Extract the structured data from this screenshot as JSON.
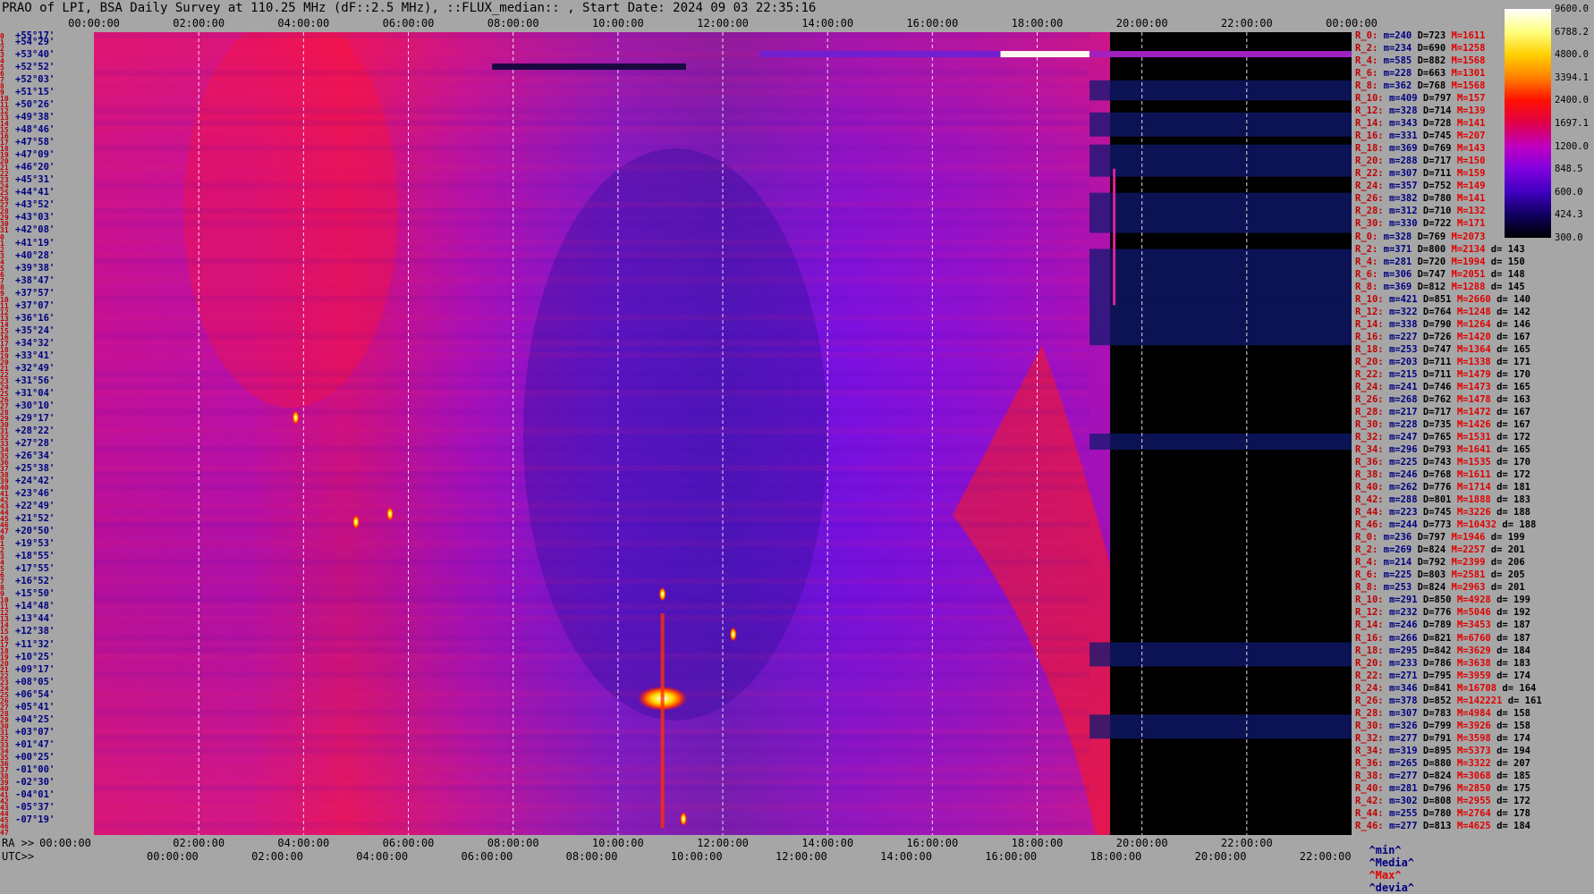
{
  "title": "PRAO of LPI, BSA Daily Survey at 110.25 MHz (dF::2.5 MHz), ::FLUX_median:: , Start Date: 2024 09 03 22:35:16",
  "top_axis_ticks": [
    "00:00:00",
    "02:00:00",
    "04:00:00",
    "06:00:00",
    "08:00:00",
    "10:00:00",
    "12:00:00",
    "14:00:00",
    "16:00:00",
    "18:00:00",
    "20:00:00",
    "22:00:00",
    "00:00:00"
  ],
  "bottom_ra_prefix": "RA >>",
  "bottom_ra_ticks": [
    "00:00:00",
    "02:00:00",
    "04:00:00",
    "06:00:00",
    "08:00:00",
    "10:00:00",
    "12:00:00",
    "14:00:00",
    "16:00:00",
    "18:00:00",
    "20:00:00",
    "22:00:00"
  ],
  "bottom_utc_prefix": "UTC>>",
  "bottom_utc_ticks": [
    "00:00:00",
    "02:00:00",
    "04:00:00",
    "06:00:00",
    "08:00:00",
    "10:00:00",
    "12:00:00",
    "14:00:00",
    "16:00:00",
    "18:00:00",
    "20:00:00",
    "22:00:00"
  ],
  "colorbar": {
    "labels": [
      "9600.0",
      "6788.2",
      "4800.0",
      "3394.1",
      "2400.0",
      "1697.1",
      "1200.0",
      "848.5",
      "600.0",
      "424.3",
      "300.0"
    ],
    "colors": [
      "#ffffff",
      "#ffff80",
      "#ffd000",
      "#ff8000",
      "#ff1000",
      "#e0004a",
      "#c000c0",
      "#8000e0",
      "#4000c0",
      "#100060",
      "#000000"
    ]
  },
  "footer": {
    "min": "^min^",
    "median": "^Media^",
    "max": "^Max^",
    "dev": "^devia^"
  },
  "declinations": [
    {
      "i": "0",
      "dec": "+55°17'"
    },
    {
      "i": "1",
      "dec": "+54°29'"
    },
    {
      "i": "2",
      "dec": ""
    },
    {
      "i": "3",
      "dec": "+53°40'"
    },
    {
      "i": "4",
      "dec": ""
    },
    {
      "i": "5",
      "dec": "+52°52'"
    },
    {
      "i": "6",
      "dec": ""
    },
    {
      "i": "7",
      "dec": "+52°03'"
    },
    {
      "i": "8",
      "dec": ""
    },
    {
      "i": "9",
      "dec": "+51°15'"
    },
    {
      "i": "10",
      "dec": ""
    },
    {
      "i": "11",
      "dec": "+50°26'"
    },
    {
      "i": "12",
      "dec": ""
    },
    {
      "i": "13",
      "dec": "+49°38'"
    },
    {
      "i": "14",
      "dec": ""
    },
    {
      "i": "15",
      "dec": "+48°46'"
    },
    {
      "i": "16",
      "dec": ""
    },
    {
      "i": "17",
      "dec": "+47°58'"
    },
    {
      "i": "18",
      "dec": ""
    },
    {
      "i": "19",
      "dec": "+47°09'"
    },
    {
      "i": "20",
      "dec": ""
    },
    {
      "i": "21",
      "dec": "+46°20'"
    },
    {
      "i": "22",
      "dec": ""
    },
    {
      "i": "23",
      "dec": "+45°31'"
    },
    {
      "i": "24",
      "dec": ""
    },
    {
      "i": "25",
      "dec": "+44°41'"
    },
    {
      "i": "26",
      "dec": ""
    },
    {
      "i": "27",
      "dec": "+43°52'"
    },
    {
      "i": "28",
      "dec": ""
    },
    {
      "i": "29",
      "dec": "+43°03'"
    },
    {
      "i": "30",
      "dec": ""
    },
    {
      "i": "31",
      "dec": "+42°08'"
    },
    {
      "i": "0",
      "dec": ""
    },
    {
      "i": "1",
      "dec": "+41°19'"
    },
    {
      "i": "2",
      "dec": ""
    },
    {
      "i": "3",
      "dec": "+40°28'"
    },
    {
      "i": "4",
      "dec": ""
    },
    {
      "i": "5",
      "dec": "+39°38'"
    },
    {
      "i": "6",
      "dec": ""
    },
    {
      "i": "7",
      "dec": "+38°47'"
    },
    {
      "i": "8",
      "dec": ""
    },
    {
      "i": "9",
      "dec": "+37°57'"
    },
    {
      "i": "10",
      "dec": ""
    },
    {
      "i": "11",
      "dec": "+37°07'"
    },
    {
      "i": "12",
      "dec": ""
    },
    {
      "i": "13",
      "dec": "+36°16'"
    },
    {
      "i": "14",
      "dec": ""
    },
    {
      "i": "15",
      "dec": "+35°24'"
    },
    {
      "i": "16",
      "dec": ""
    },
    {
      "i": "17",
      "dec": "+34°32'"
    },
    {
      "i": "18",
      "dec": ""
    },
    {
      "i": "19",
      "dec": "+33°41'"
    },
    {
      "i": "20",
      "dec": ""
    },
    {
      "i": "21",
      "dec": "+32°49'"
    },
    {
      "i": "22",
      "dec": ""
    },
    {
      "i": "23",
      "dec": "+31°56'"
    },
    {
      "i": "24",
      "dec": ""
    },
    {
      "i": "25",
      "dec": "+31°04'"
    },
    {
      "i": "26",
      "dec": ""
    },
    {
      "i": "27",
      "dec": "+30°10'"
    },
    {
      "i": "28",
      "dec": ""
    },
    {
      "i": "29",
      "dec": "+29°17'"
    },
    {
      "i": "30",
      "dec": ""
    },
    {
      "i": "31",
      "dec": "+28°22'"
    },
    {
      "i": "32",
      "dec": ""
    },
    {
      "i": "33",
      "dec": "+27°28'"
    },
    {
      "i": "34",
      "dec": ""
    },
    {
      "i": "35",
      "dec": "+26°34'"
    },
    {
      "i": "36",
      "dec": ""
    },
    {
      "i": "37",
      "dec": "+25°38'"
    },
    {
      "i": "38",
      "dec": ""
    },
    {
      "i": "39",
      "dec": "+24°42'"
    },
    {
      "i": "40",
      "dec": ""
    },
    {
      "i": "41",
      "dec": "+23°46'"
    },
    {
      "i": "42",
      "dec": ""
    },
    {
      "i": "43",
      "dec": "+22°49'"
    },
    {
      "i": "44",
      "dec": ""
    },
    {
      "i": "45",
      "dec": "+21°52'"
    },
    {
      "i": "46",
      "dec": ""
    },
    {
      "i": "47",
      "dec": "+20°50'"
    },
    {
      "i": "0",
      "dec": ""
    },
    {
      "i": "1",
      "dec": "+19°53'"
    },
    {
      "i": "2",
      "dec": ""
    },
    {
      "i": "3",
      "dec": "+18°55'"
    },
    {
      "i": "4",
      "dec": ""
    },
    {
      "i": "5",
      "dec": "+17°55'"
    },
    {
      "i": "6",
      "dec": ""
    },
    {
      "i": "7",
      "dec": "+16°52'"
    },
    {
      "i": "8",
      "dec": ""
    },
    {
      "i": "9",
      "dec": "+15°50'"
    },
    {
      "i": "10",
      "dec": ""
    },
    {
      "i": "11",
      "dec": "+14°48'"
    },
    {
      "i": "12",
      "dec": ""
    },
    {
      "i": "13",
      "dec": "+13°44'"
    },
    {
      "i": "14",
      "dec": ""
    },
    {
      "i": "15",
      "dec": "+12°38'"
    },
    {
      "i": "16",
      "dec": ""
    },
    {
      "i": "17",
      "dec": "+11°32'"
    },
    {
      "i": "18",
      "dec": ""
    },
    {
      "i": "19",
      "dec": "+10°25'"
    },
    {
      "i": "20",
      "dec": ""
    },
    {
      "i": "21",
      "dec": "+09°17'"
    },
    {
      "i": "22",
      "dec": ""
    },
    {
      "i": "23",
      "dec": "+08°05'"
    },
    {
      "i": "24",
      "dec": ""
    },
    {
      "i": "25",
      "dec": "+06°54'"
    },
    {
      "i": "26",
      "dec": ""
    },
    {
      "i": "27",
      "dec": "+05°41'"
    },
    {
      "i": "28",
      "dec": ""
    },
    {
      "i": "29",
      "dec": "+04°25'"
    },
    {
      "i": "30",
      "dec": ""
    },
    {
      "i": "31",
      "dec": "+03°07'"
    },
    {
      "i": "32",
      "dec": ""
    },
    {
      "i": "33",
      "dec": "+01°47'"
    },
    {
      "i": "34",
      "dec": ""
    },
    {
      "i": "35",
      "dec": "+00°25'"
    },
    {
      "i": "36",
      "dec": ""
    },
    {
      "i": "37",
      "dec": "-01°00'"
    },
    {
      "i": "38",
      "dec": ""
    },
    {
      "i": "39",
      "dec": "-02°30'"
    },
    {
      "i": "40",
      "dec": ""
    },
    {
      "i": "41",
      "dec": "-04°01'"
    },
    {
      "i": "42",
      "dec": ""
    },
    {
      "i": "43",
      "dec": "-05°37'"
    },
    {
      "i": "44",
      "dec": ""
    },
    {
      "i": "45",
      "dec": "-07°19'"
    },
    {
      "i": "46",
      "dec": ""
    },
    {
      "i": "47",
      "dec": ""
    }
  ],
  "stats": [
    {
      "r": "R_0:",
      "m": "m=240",
      "d": "D=723",
      "M": "M=1611",
      "dev": ""
    },
    {
      "r": "R_2:",
      "m": "m=234",
      "d": "D=690",
      "M": "M=1258",
      "dev": ""
    },
    {
      "r": "R_4:",
      "m": "m=585",
      "d": "D=882",
      "M": "M=1568",
      "dev": ""
    },
    {
      "r": "R_6:",
      "m": "m=228",
      "d": "D=663",
      "M": "M=1301",
      "dev": ""
    },
    {
      "r": "R_8:",
      "m": "m=362",
      "d": "D=768",
      "M": "M=1568",
      "dev": ""
    },
    {
      "r": "R_10:",
      "m": "m=409",
      "d": "D=797",
      "M": "M=157",
      "dev": ""
    },
    {
      "r": "R_12:",
      "m": "m=328",
      "d": "D=714",
      "M": "M=139",
      "dev": ""
    },
    {
      "r": "R_14:",
      "m": "m=343",
      "d": "D=728",
      "M": "M=141",
      "dev": ""
    },
    {
      "r": "R_16:",
      "m": "m=331",
      "d": "D=745",
      "M": "M=207",
      "dev": ""
    },
    {
      "r": "R_18:",
      "m": "m=369",
      "d": "D=769",
      "M": "M=143",
      "dev": ""
    },
    {
      "r": "R_20:",
      "m": "m=288",
      "d": "D=717",
      "M": "M=150",
      "dev": ""
    },
    {
      "r": "R_22:",
      "m": "m=307",
      "d": "D=711",
      "M": "M=159",
      "dev": ""
    },
    {
      "r": "R_24:",
      "m": "m=357",
      "d": "D=752",
      "M": "M=149",
      "dev": ""
    },
    {
      "r": "R_26:",
      "m": "m=382",
      "d": "D=780",
      "M": "M=141",
      "dev": ""
    },
    {
      "r": "R_28:",
      "m": "m=312",
      "d": "D=710",
      "M": "M=132",
      "dev": ""
    },
    {
      "r": "R_30:",
      "m": "m=330",
      "d": "D=722",
      "M": "M=171",
      "dev": ""
    },
    {
      "r": "R_0:",
      "m": "m=328",
      "d": "D=769",
      "M": "M=2073",
      "dev": ""
    },
    {
      "r": "R_2:",
      "m": "m=371",
      "d": "D=800",
      "M": "M=2134",
      "dev": "d= 143"
    },
    {
      "r": "R_4:",
      "m": "m=281",
      "d": "D=720",
      "M": "M=1994",
      "dev": "d= 150"
    },
    {
      "r": "R_6:",
      "m": "m=306",
      "d": "D=747",
      "M": "M=2051",
      "dev": "d= 148"
    },
    {
      "r": "R_8:",
      "m": "m=369",
      "d": "D=812",
      "M": "M=1288",
      "dev": "d= 145"
    },
    {
      "r": "R_10:",
      "m": "m=421",
      "d": "D=851",
      "M": "M=2660",
      "dev": "d= 140"
    },
    {
      "r": "R_12:",
      "m": "m=322",
      "d": "D=764",
      "M": "M=1248",
      "dev": "d= 142"
    },
    {
      "r": "R_14:",
      "m": "m=338",
      "d": "D=790",
      "M": "M=1264",
      "dev": "d= 146"
    },
    {
      "r": "R_16:",
      "m": "m=227",
      "d": "D=726",
      "M": "M=1420",
      "dev": "d= 167"
    },
    {
      "r": "R_18:",
      "m": "m=253",
      "d": "D=747",
      "M": "M=1364",
      "dev": "d= 165"
    },
    {
      "r": "R_20:",
      "m": "m=203",
      "d": "D=711",
      "M": "M=1338",
      "dev": "d= 171"
    },
    {
      "r": "R_22:",
      "m": "m=215",
      "d": "D=711",
      "M": "M=1479",
      "dev": "d= 170"
    },
    {
      "r": "R_24:",
      "m": "m=241",
      "d": "D=746",
      "M": "M=1473",
      "dev": "d= 165"
    },
    {
      "r": "R_26:",
      "m": "m=268",
      "d": "D=762",
      "M": "M=1478",
      "dev": "d= 163"
    },
    {
      "r": "R_28:",
      "m": "m=217",
      "d": "D=717",
      "M": "M=1472",
      "dev": "d= 167"
    },
    {
      "r": "R_30:",
      "m": "m=228",
      "d": "D=735",
      "M": "M=1426",
      "dev": "d= 167"
    },
    {
      "r": "R_32:",
      "m": "m=247",
      "d": "D=765",
      "M": "M=1531",
      "dev": "d= 172"
    },
    {
      "r": "R_34:",
      "m": "m=296",
      "d": "D=793",
      "M": "M=1641",
      "dev": "d= 165"
    },
    {
      "r": "R_36:",
      "m": "m=225",
      "d": "D=743",
      "M": "M=1535",
      "dev": "d= 170"
    },
    {
      "r": "R_38:",
      "m": "m=246",
      "d": "D=768",
      "M": "M=1611",
      "dev": "d= 172"
    },
    {
      "r": "R_40:",
      "m": "m=262",
      "d": "D=776",
      "M": "M=1714",
      "dev": "d= 181"
    },
    {
      "r": "R_42:",
      "m": "m=288",
      "d": "D=801",
      "M": "M=1888",
      "dev": "d= 183"
    },
    {
      "r": "R_44:",
      "m": "m=223",
      "d": "D=745",
      "M": "M=3226",
      "dev": "d= 188"
    },
    {
      "r": "R_46:",
      "m": "m=244",
      "d": "D=773",
      "M": "M=10432",
      "dev": "d= 188"
    },
    {
      "r": "R_0:",
      "m": "m=236",
      "d": "D=797",
      "M": "M=1946",
      "dev": "d= 199"
    },
    {
      "r": "R_2:",
      "m": "m=269",
      "d": "D=824",
      "M": "M=2257",
      "dev": "d= 201"
    },
    {
      "r": "R_4:",
      "m": "m=214",
      "d": "D=792",
      "M": "M=2399",
      "dev": "d= 206"
    },
    {
      "r": "R_6:",
      "m": "m=225",
      "d": "D=803",
      "M": "M=2581",
      "dev": "d= 205"
    },
    {
      "r": "R_8:",
      "m": "m=253",
      "d": "D=824",
      "M": "M=2963",
      "dev": "d= 201"
    },
    {
      "r": "R_10:",
      "m": "m=291",
      "d": "D=850",
      "M": "M=4928",
      "dev": "d= 199"
    },
    {
      "r": "R_12:",
      "m": "m=232",
      "d": "D=776",
      "M": "M=5046",
      "dev": "d= 192"
    },
    {
      "r": "R_14:",
      "m": "m=246",
      "d": "D=789",
      "M": "M=3453",
      "dev": "d= 187"
    },
    {
      "r": "R_16:",
      "m": "m=266",
      "d": "D=821",
      "M": "M=6760",
      "dev": "d= 187"
    },
    {
      "r": "R_18:",
      "m": "m=295",
      "d": "D=842",
      "M": "M=3629",
      "dev": "d= 184"
    },
    {
      "r": "R_20:",
      "m": "m=233",
      "d": "D=786",
      "M": "M=3638",
      "dev": "d= 183"
    },
    {
      "r": "R_22:",
      "m": "m=271",
      "d": "D=795",
      "M": "M=3959",
      "dev": "d= 174"
    },
    {
      "r": "R_24:",
      "m": "m=346",
      "d": "D=841",
      "M": "M=16708",
      "dev": "d= 164"
    },
    {
      "r": "R_26:",
      "m": "m=378",
      "d": "D=852",
      "M": "M=142221",
      "dev": "d= 161"
    },
    {
      "r": "R_28:",
      "m": "m=307",
      "d": "D=783",
      "M": "M=4984",
      "dev": "d= 158"
    },
    {
      "r": "R_30:",
      "m": "m=326",
      "d": "D=799",
      "M": "M=3926",
      "dev": "d= 158"
    },
    {
      "r": "R_32:",
      "m": "m=277",
      "d": "D=791",
      "M": "M=3598",
      "dev": "d= 174"
    },
    {
      "r": "R_34:",
      "m": "m=319",
      "d": "D=895",
      "M": "M=5373",
      "dev": "d= 194"
    },
    {
      "r": "R_36:",
      "m": "m=265",
      "d": "D=880",
      "M": "M=3322",
      "dev": "d= 207"
    },
    {
      "r": "R_38:",
      "m": "m=277",
      "d": "D=824",
      "M": "M=3068",
      "dev": "d= 185"
    },
    {
      "r": "R_40:",
      "m": "m=281",
      "d": "D=796",
      "M": "M=2850",
      "dev": "d= 175"
    },
    {
      "r": "R_42:",
      "m": "m=302",
      "d": "D=808",
      "M": "M=2955",
      "dev": "d= 172"
    },
    {
      "r": "R_44:",
      "m": "m=255",
      "d": "D=780",
      "M": "M=2764",
      "dev": "d= 178"
    },
    {
      "r": "R_46:",
      "m": "m=277",
      "d": "D=813",
      "M": "M=4625",
      "dev": "d= 184"
    }
  ],
  "chart_data": {
    "type": "heatmap",
    "x_axis": "UTC (hours)",
    "x_range": [
      0,
      24
    ],
    "y_rows": 128,
    "colormap_range": [
      300.0,
      9600.0
    ],
    "colormap_scale": "log",
    "data_gap_start_hour": 19.0,
    "bright_sources": [
      {
        "hour": 10.85,
        "row_frac": 0.83,
        "intensity": 9600
      },
      {
        "hour": 10.85,
        "row_frac": 0.7,
        "intensity": 4800
      },
      {
        "hour": 11.25,
        "row_frac": 0.98,
        "intensity": 6788
      },
      {
        "hour": 12.2,
        "row_frac": 0.75,
        "intensity": 4800
      },
      {
        "hour": 5.0,
        "row_frac": 0.61,
        "intensity": 6788
      },
      {
        "hour": 5.65,
        "row_frac": 0.6,
        "intensity": 3394
      },
      {
        "hour": 3.85,
        "row_frac": 0.48,
        "intensity": 3394
      }
    ],
    "interference_band": {
      "row": 3,
      "hour_start": 17.3,
      "hour_end": 19.0,
      "intensity": 9600
    }
  }
}
